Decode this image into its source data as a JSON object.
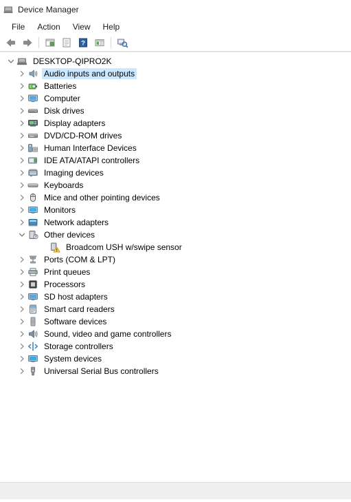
{
  "window": {
    "title": "Device Manager",
    "icon": "device-manager-icon"
  },
  "menubar": {
    "items": [
      {
        "label": "File",
        "name": "menu-file"
      },
      {
        "label": "Action",
        "name": "menu-action"
      },
      {
        "label": "View",
        "name": "menu-view"
      },
      {
        "label": "Help",
        "name": "menu-help"
      }
    ]
  },
  "toolbar": {
    "buttons": [
      {
        "name": "back-arrow-icon",
        "title": "Back"
      },
      {
        "name": "forward-arrow-icon",
        "title": "Forward"
      },
      {
        "name": "separator-1",
        "title": ""
      },
      {
        "name": "properties-icon",
        "title": "Properties"
      },
      {
        "name": "update-driver-icon",
        "title": "Update driver"
      },
      {
        "name": "help-icon",
        "title": "Help"
      },
      {
        "name": "show-hidden-devices-icon",
        "title": "Show hidden devices"
      },
      {
        "name": "separator-2",
        "title": ""
      },
      {
        "name": "scan-hardware-changes-icon",
        "title": "Scan for hardware changes"
      }
    ]
  },
  "tree": {
    "root": {
      "label": "DESKTOP-QIPRO2K",
      "icon": "computer-root-icon",
      "expanded": true
    },
    "nodes": [
      {
        "label": "Audio inputs and outputs",
        "icon": "speaker-icon",
        "expanded": false,
        "selected": true,
        "depth": 1
      },
      {
        "label": "Batteries",
        "icon": "battery-icon",
        "expanded": false,
        "selected": false,
        "depth": 1
      },
      {
        "label": "Computer",
        "icon": "monitor-icon",
        "expanded": false,
        "selected": false,
        "depth": 1
      },
      {
        "label": "Disk drives",
        "icon": "disk-drive-icon",
        "expanded": false,
        "selected": false,
        "depth": 1
      },
      {
        "label": "Display adapters",
        "icon": "display-adapter-icon",
        "expanded": false,
        "selected": false,
        "depth": 1
      },
      {
        "label": "DVD/CD-ROM drives",
        "icon": "dvd-drive-icon",
        "expanded": false,
        "selected": false,
        "depth": 1
      },
      {
        "label": "Human Interface Devices",
        "icon": "hid-icon",
        "expanded": false,
        "selected": false,
        "depth": 1
      },
      {
        "label": "IDE ATA/ATAPI controllers",
        "icon": "ide-controller-icon",
        "expanded": false,
        "selected": false,
        "depth": 1
      },
      {
        "label": "Imaging devices",
        "icon": "imaging-device-icon",
        "expanded": false,
        "selected": false,
        "depth": 1
      },
      {
        "label": "Keyboards",
        "icon": "keyboard-icon",
        "expanded": false,
        "selected": false,
        "depth": 1
      },
      {
        "label": "Mice and other pointing devices",
        "icon": "mouse-icon",
        "expanded": false,
        "selected": false,
        "depth": 1
      },
      {
        "label": "Monitors",
        "icon": "monitors-icon",
        "expanded": false,
        "selected": false,
        "depth": 1
      },
      {
        "label": "Network adapters",
        "icon": "network-adapter-icon",
        "expanded": false,
        "selected": false,
        "depth": 1
      },
      {
        "label": "Other devices",
        "icon": "unknown-device-icon",
        "expanded": true,
        "selected": false,
        "depth": 1
      },
      {
        "label": "Broadcom USH w/swipe sensor",
        "icon": "unknown-device-warning-icon",
        "expanded": null,
        "selected": false,
        "depth": 2
      },
      {
        "label": "Ports (COM & LPT)",
        "icon": "port-icon",
        "expanded": false,
        "selected": false,
        "depth": 1
      },
      {
        "label": "Print queues",
        "icon": "printer-icon",
        "expanded": false,
        "selected": false,
        "depth": 1
      },
      {
        "label": "Processors",
        "icon": "processor-icon",
        "expanded": false,
        "selected": false,
        "depth": 1
      },
      {
        "label": "SD host adapters",
        "icon": "sd-host-adapter-icon",
        "expanded": false,
        "selected": false,
        "depth": 1
      },
      {
        "label": "Smart card readers",
        "icon": "smart-card-reader-icon",
        "expanded": false,
        "selected": false,
        "depth": 1
      },
      {
        "label": "Software devices",
        "icon": "software-device-icon",
        "expanded": false,
        "selected": false,
        "depth": 1
      },
      {
        "label": "Sound, video and game controllers",
        "icon": "sound-controller-icon",
        "expanded": false,
        "selected": false,
        "depth": 1
      },
      {
        "label": "Storage controllers",
        "icon": "storage-controller-icon",
        "expanded": false,
        "selected": false,
        "depth": 1
      },
      {
        "label": "System devices",
        "icon": "system-device-icon",
        "expanded": false,
        "selected": false,
        "depth": 1
      },
      {
        "label": "Universal Serial Bus controllers",
        "icon": "usb-controller-icon",
        "expanded": false,
        "selected": false,
        "depth": 1
      }
    ]
  },
  "statusbar": {
    "text": ""
  },
  "colors": {
    "selection": "#cce8ff",
    "warning": "#ffd24d",
    "accent_blue": "#2a5fa5",
    "icon_gray": "#6d6d6d",
    "statusbar_bg": "#efeff0"
  }
}
